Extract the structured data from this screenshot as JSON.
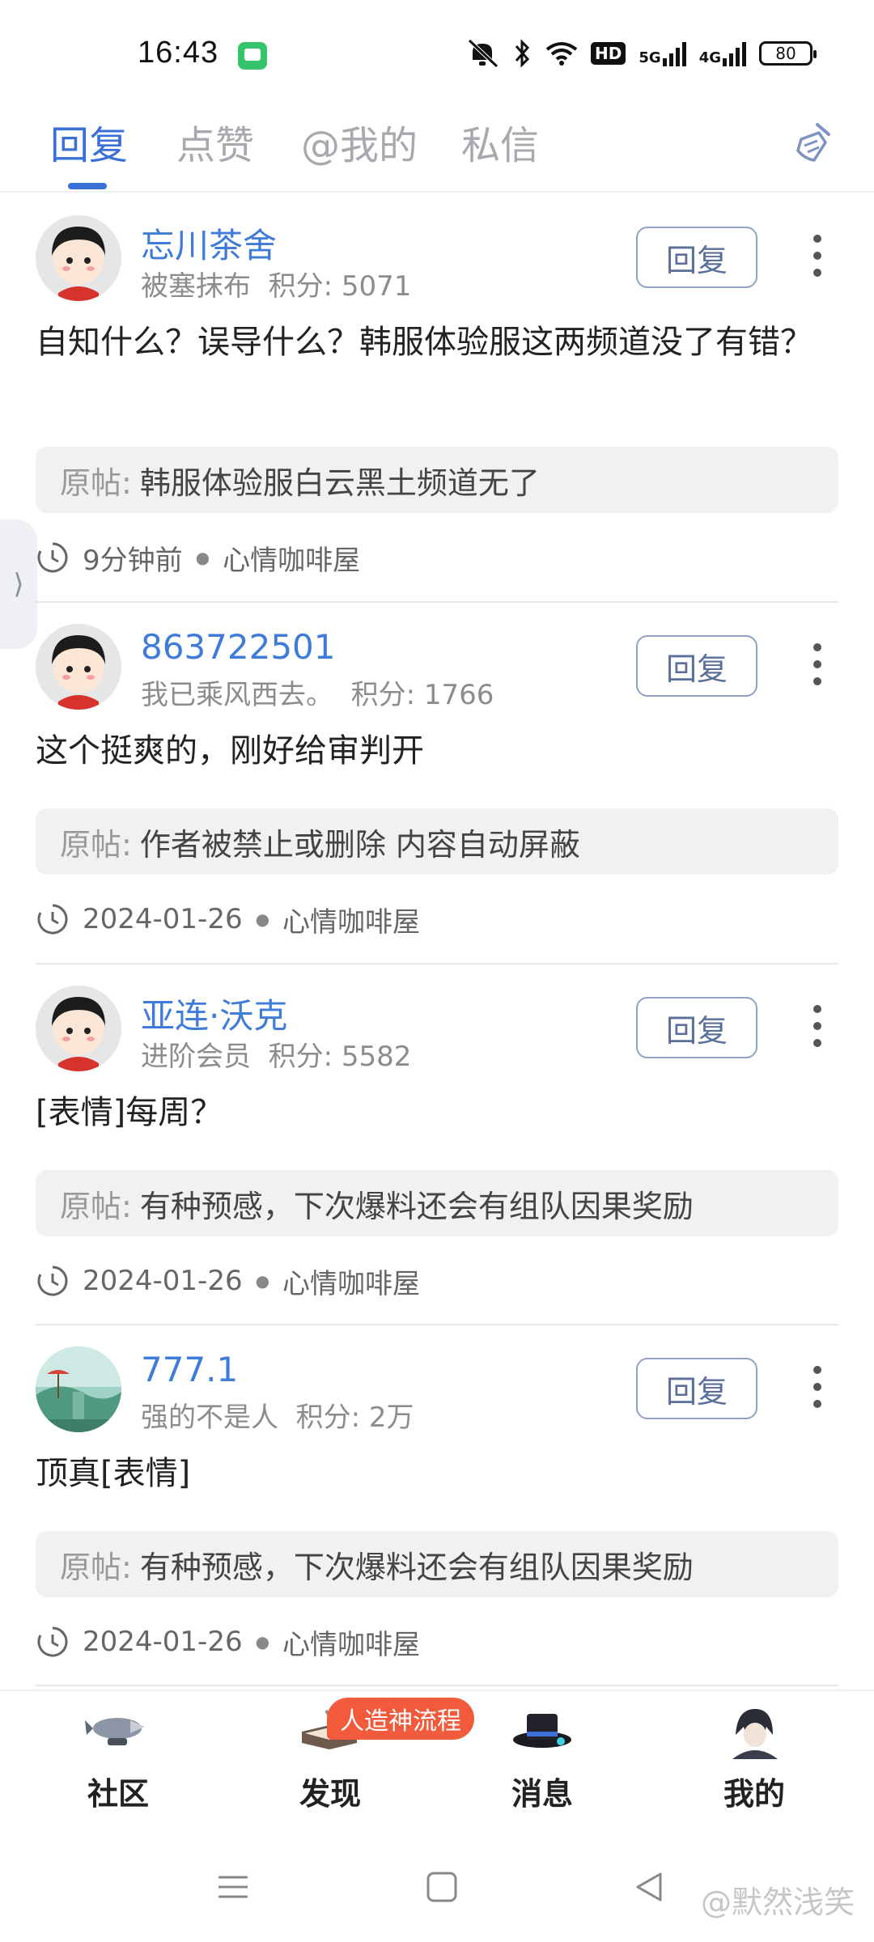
{
  "status_bar": {
    "time": "16:43",
    "net_5g": "5G",
    "net_4g": "4G",
    "hd": "HD",
    "battery": "80"
  },
  "tabs": [
    {
      "label": "回复",
      "active": true
    },
    {
      "label": "点赞",
      "active": false
    },
    {
      "label": "@我的",
      "active": false
    },
    {
      "label": "私信",
      "active": false
    }
  ],
  "side_handle_glyph": "⟩",
  "orig_label": "原帖:",
  "reply_label": "回复",
  "posts": [
    {
      "name": "忘川茶舍",
      "title": "被塞抹布",
      "points": "积分: 5071",
      "text": "自知什么？误导什么？韩服体验服这两频道没了有错？",
      "orig": "韩服体验服白云黑土频道无了",
      "time": "9分钟前",
      "board": "心情咖啡屋"
    },
    {
      "name": "863722501",
      "title": "我已乘风西去。",
      "points": "积分: 1766",
      "text": "这个挺爽的，刚好给审判开",
      "orig": "作者被禁止或删除 内容自动屏蔽",
      "time": "2024-01-26",
      "board": "心情咖啡屋"
    },
    {
      "name": "亚连·沃克",
      "title": "进阶会员",
      "points": "积分: 5582",
      "text": "[表情]每周？",
      "orig": "有种预感，下次爆料还会有组队因果奖励",
      "time": "2024-01-26",
      "board": "心情咖啡屋"
    },
    {
      "name": "777.1",
      "title": "强的不是人",
      "points": "积分: 2万",
      "text": "顶真[表情]",
      "orig": "有种预感，下次爆料还会有组队因果奖励",
      "time": "2024-01-26",
      "board": "心情咖啡屋"
    }
  ],
  "bottom_nav": [
    {
      "label": "社区",
      "active": false
    },
    {
      "label": "发现",
      "active": false
    },
    {
      "label": "消息",
      "active": true
    },
    {
      "label": "我的",
      "active": false
    }
  ],
  "promo_badge": "人造神流程",
  "watermark": "@默然浅笑",
  "colors": {
    "accent_blue": "#3a6fd8",
    "username_blue": "#3f7bd9",
    "active_nav_orange": "#f08a17",
    "badge_red": "#f25a3c"
  }
}
